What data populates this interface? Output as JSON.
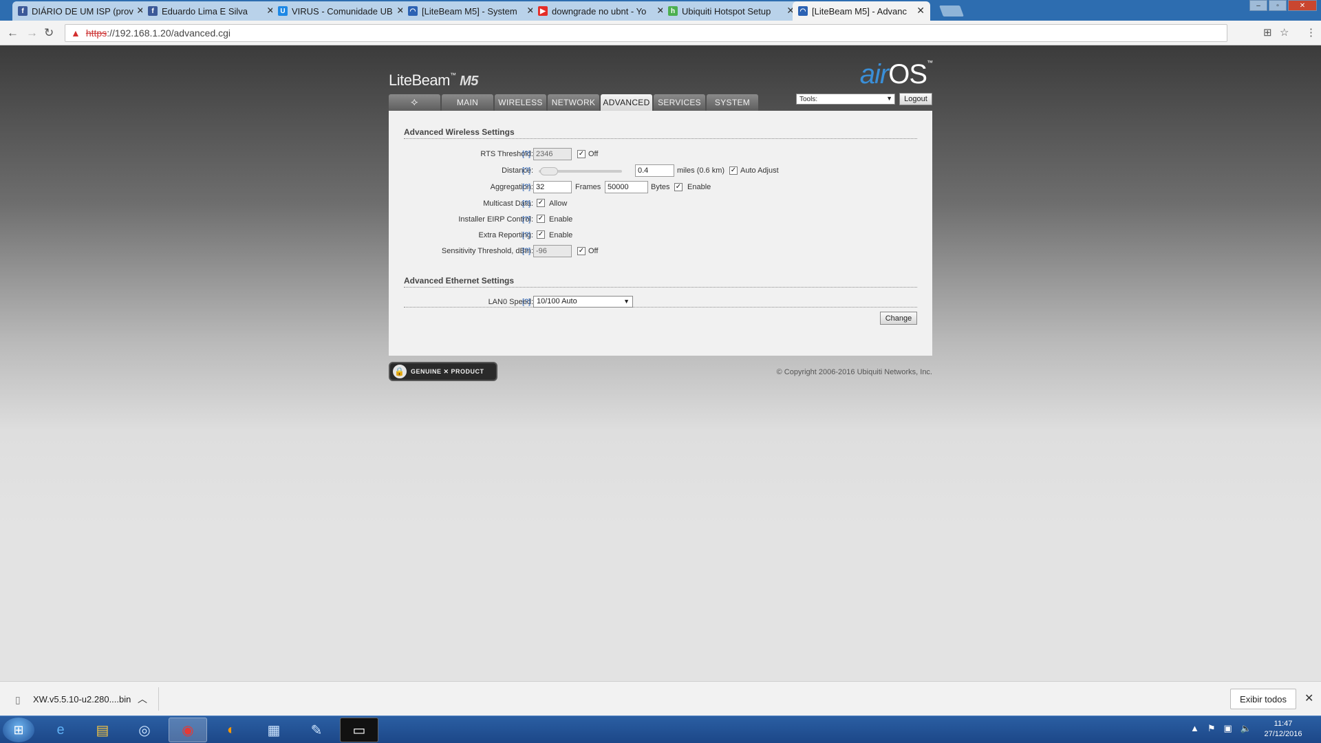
{
  "browser": {
    "tabs": [
      {
        "title": "DIÁRIO DE UM ISP (prov",
        "icon": "facebook-icon",
        "color": "#3b5998",
        "glyph": "f"
      },
      {
        "title": "Eduardo Lima E Silva",
        "icon": "facebook-icon",
        "color": "#3b5998",
        "glyph": "f"
      },
      {
        "title": "VIRUS - Comunidade UB",
        "icon": "ubiquiti-community-icon",
        "color": "#1e88e5",
        "glyph": "U"
      },
      {
        "title": "[LiteBeam M5] - System",
        "icon": "wifi-icon",
        "color": "#2c62b3",
        "glyph": "◠"
      },
      {
        "title": "downgrade no ubnt - Yo",
        "icon": "youtube-icon",
        "color": "#e52d27",
        "glyph": "▶"
      },
      {
        "title": "Ubiquiti Hotspot Setup",
        "icon": "hotspot-icon",
        "color": "#4caf50",
        "glyph": "h"
      },
      {
        "title": "[LiteBeam M5] - Advanc",
        "icon": "wifi-icon",
        "color": "#2c62b3",
        "glyph": "◠"
      }
    ],
    "url_scheme": "https",
    "url_rest": "://192.168.1.20/advanced.cgi"
  },
  "app": {
    "brand": "LiteBeam",
    "brand_tm": "™",
    "model": "M5",
    "airos_air": "air",
    "airos_os": "OS",
    "airos_tm": "™",
    "tabs": [
      {
        "label": "MAIN"
      },
      {
        "label": "WIRELESS"
      },
      {
        "label": "NETWORK"
      },
      {
        "label": "ADVANCED",
        "active": true
      },
      {
        "label": "SERVICES"
      },
      {
        "label": "SYSTEM"
      }
    ],
    "tools_label": "Tools:",
    "logout_label": "Logout"
  },
  "wireless": {
    "section_title": "Advanced Wireless Settings",
    "help": "[?]",
    "rts": {
      "label": "RTS Threshold:",
      "value": "2346",
      "off_label": "Off",
      "off_checked": true
    },
    "distance": {
      "label": "Distance:",
      "value": "0.4",
      "units": "miles (0.6 km)",
      "auto_label": "Auto Adjust",
      "auto_checked": true
    },
    "aggregation": {
      "label": "Aggregation:",
      "frames_value": "32",
      "frames_label": "Frames",
      "bytes_value": "50000",
      "bytes_label": "Bytes",
      "enable_label": "Enable",
      "enable_checked": true
    },
    "multicast": {
      "label": "Multicast Data:",
      "allow_label": "Allow",
      "checked": true
    },
    "eirp": {
      "label": "Installer EIRP Control:",
      "enable_label": "Enable",
      "checked": true
    },
    "extra": {
      "label": "Extra Reporting:",
      "enable_label": "Enable",
      "checked": true
    },
    "sensitivity": {
      "label": "Sensitivity Threshold, dBm:",
      "value": "-96",
      "off_label": "Off",
      "off_checked": true
    }
  },
  "ethernet": {
    "section_title": "Advanced Ethernet Settings",
    "lan0": {
      "label": "LAN0 Speed:",
      "value": "10/100 Auto"
    }
  },
  "change_label": "Change",
  "genuine_text": "GENUINE ✕ PRODUCT",
  "copyright": "© Copyright 2006-2016 Ubiquiti Networks, Inc.",
  "download": {
    "filename": "XW.v5.5.10-u2.280....bin",
    "show_all": "Exibir todos"
  },
  "taskbar": {
    "time": "11:47",
    "date": "27/12/2016"
  }
}
